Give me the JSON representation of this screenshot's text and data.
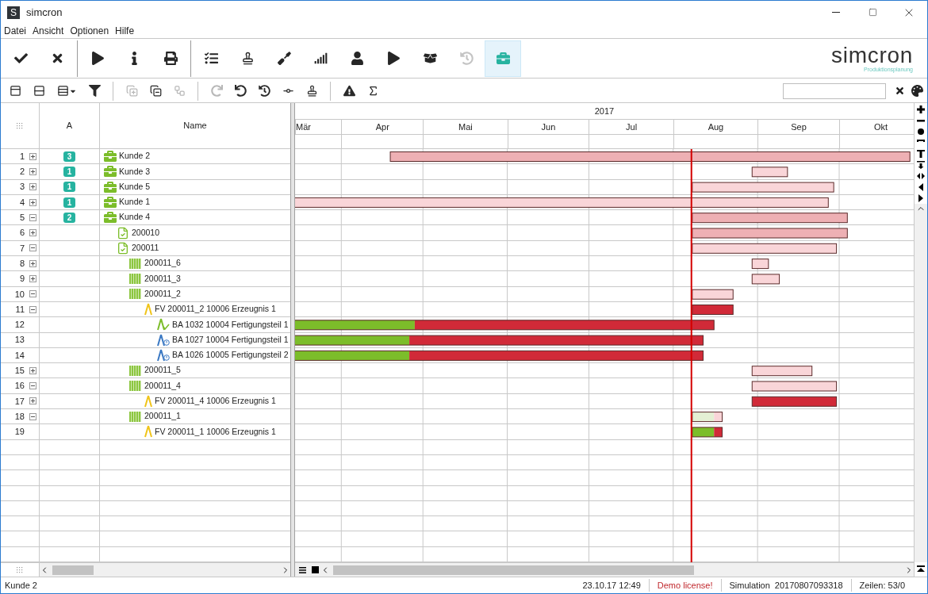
{
  "window": {
    "app_icon_letter": "S",
    "title": "simcron"
  },
  "menu": [
    "Datei",
    "Ansicht",
    "Optionen",
    "Hilfe"
  ],
  "toolbar": {
    "groups": [
      [
        {
          "kind": "confirm",
          "disabled": false,
          "selected": false
        },
        {
          "kind": "cancel",
          "disabled": false,
          "selected": false
        }
      ],
      [
        {
          "kind": "play",
          "disabled": false,
          "selected": false
        },
        {
          "kind": "info",
          "disabled": false,
          "selected": false
        },
        {
          "kind": "print",
          "disabled": false,
          "selected": false
        }
      ],
      [
        {
          "kind": "tasks",
          "disabled": false,
          "selected": false
        },
        {
          "kind": "stamp",
          "disabled": false,
          "selected": false
        },
        {
          "kind": "screwdriver",
          "disabled": false,
          "selected": false
        },
        {
          "kind": "signal",
          "disabled": false,
          "selected": false
        },
        {
          "kind": "user",
          "disabled": false,
          "selected": false
        },
        {
          "kind": "run",
          "disabled": false,
          "selected": false
        },
        {
          "kind": "box",
          "disabled": false,
          "selected": false
        },
        {
          "kind": "history",
          "disabled": true,
          "selected": false
        },
        {
          "kind": "briefcase",
          "disabled": false,
          "selected": true
        }
      ]
    ]
  },
  "logo": {
    "name": "simcron",
    "tagline": "Produktionsplanung"
  },
  "toolbar2": {
    "groups": [
      [
        {
          "kind": "panel",
          "disabled": false
        },
        {
          "kind": "rows",
          "disabled": false
        },
        {
          "kind": "rowsmenu",
          "disabled": false
        },
        {
          "kind": "filter",
          "disabled": false
        }
      ],
      [
        {
          "kind": "copyplus",
          "disabled": true
        },
        {
          "kind": "copyminus",
          "disabled": false
        },
        {
          "kind": "connector",
          "disabled": true
        }
      ],
      [
        {
          "kind": "redo",
          "disabled": true
        },
        {
          "kind": "undo",
          "disabled": false
        },
        {
          "kind": "clock",
          "disabled": false
        },
        {
          "kind": "nodes",
          "disabled": false
        },
        {
          "kind": "stamp",
          "disabled": false
        }
      ],
      [
        {
          "kind": "warning",
          "disabled": false
        },
        {
          "kind": "sigma",
          "disabled": false
        }
      ]
    ]
  },
  "columns": [
    "A",
    "Name"
  ],
  "rows": [
    {
      "no": "1",
      "expanded": false,
      "badge": "3",
      "kind": "customer",
      "label": "Kunde 2"
    },
    {
      "no": "2",
      "expanded": false,
      "badge": "1",
      "kind": "customer",
      "label": "Kunde 3"
    },
    {
      "no": "3",
      "expanded": false,
      "badge": "1",
      "kind": "customer",
      "label": "Kunde 5"
    },
    {
      "no": "4",
      "expanded": false,
      "badge": "1",
      "kind": "customer",
      "label": "Kunde 1"
    },
    {
      "no": "5",
      "expanded": true,
      "badge": "2",
      "kind": "customer",
      "label": "Kunde 4",
      "children": [
        {
          "no": "6",
          "expanded": false,
          "kind": "order",
          "label": "200010"
        },
        {
          "no": "7",
          "expanded": true,
          "kind": "order",
          "label": "200011",
          "children": [
            {
              "no": "8",
              "expanded": false,
              "kind": "lot",
              "label": "200011_6"
            },
            {
              "no": "9",
              "expanded": false,
              "kind": "lot",
              "label": "200011_3"
            },
            {
              "no": "10",
              "expanded": true,
              "kind": "lot",
              "label": "200011_2",
              "children": [
                {
                  "no": "11",
                  "expanded": true,
                  "kind": "assembly",
                  "label": "FV 200011_2 10006 Erzeugnis 1",
                  "children": [
                    {
                      "no": "12",
                      "kind": "done",
                      "label": "BA 1032 10004 Fertigungsteil 1"
                    },
                    {
                      "no": "13",
                      "kind": "waiting",
                      "label": "BA 1027 10004 Fertigungsteil 1"
                    },
                    {
                      "no": "14",
                      "kind": "waiting",
                      "label": "BA 1026 10005 Fertigungsteil 2"
                    }
                  ]
                }
              ]
            },
            {
              "no": "15",
              "expanded": false,
              "kind": "lot",
              "label": "200011_5"
            },
            {
              "no": "16",
              "expanded": true,
              "kind": "lot",
              "label": "200011_4",
              "children": [
                {
                  "no": "17",
                  "expanded": false,
                  "kind": "assembly",
                  "label": "FV 200011_4 10006 Erzeugnis 1"
                }
              ]
            },
            {
              "no": "18",
              "expanded": true,
              "kind": "lot",
              "label": "200011_1",
              "children": [
                {
                  "no": "19",
                  "kind": "assembly",
                  "label": "FV 200011_1 10006 Erzeugnis 1"
                }
              ]
            }
          ]
        }
      ]
    }
  ],
  "timeline": {
    "year": "2017",
    "months": [
      "Mär",
      "Apr",
      "Mai",
      "Jun",
      "Jul",
      "Aug",
      "Sep",
      "Okt"
    ]
  },
  "status_bar": {
    "selection": "Kunde 2",
    "datetime": "23.10.17 12:49",
    "license": "Demo license!",
    "simulation_label": "Simulation",
    "simulation_id": "20170807093318",
    "rows": "Zeilen: 53/0"
  }
}
